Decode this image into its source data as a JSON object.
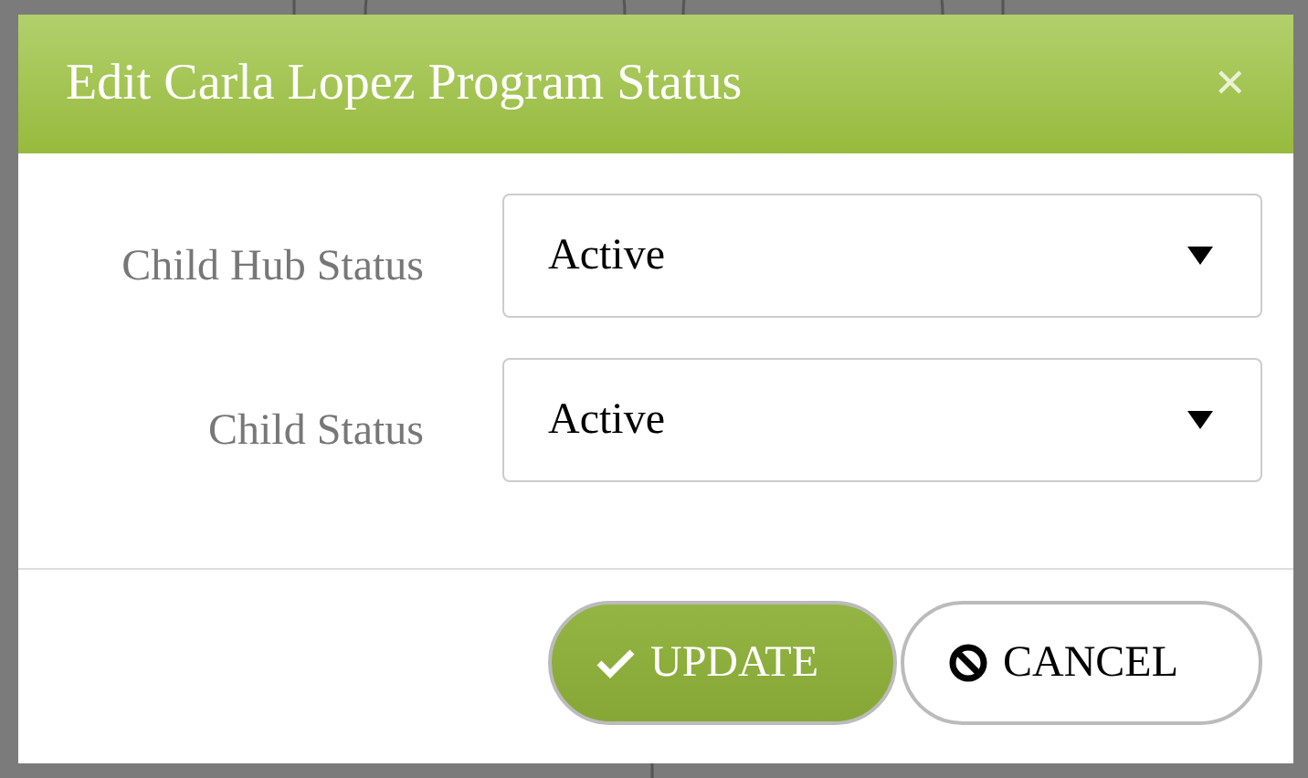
{
  "dialog": {
    "title": "Edit Carla Lopez Program Status",
    "close": "×"
  },
  "fields": [
    {
      "label": "Child Hub Status",
      "value": "Active"
    },
    {
      "label": "Child Status",
      "value": "Active"
    }
  ],
  "buttons": [
    {
      "label": "UPDATE",
      "kind": "primary"
    },
    {
      "label": "CANCEL",
      "kind": "secondary"
    }
  ]
}
